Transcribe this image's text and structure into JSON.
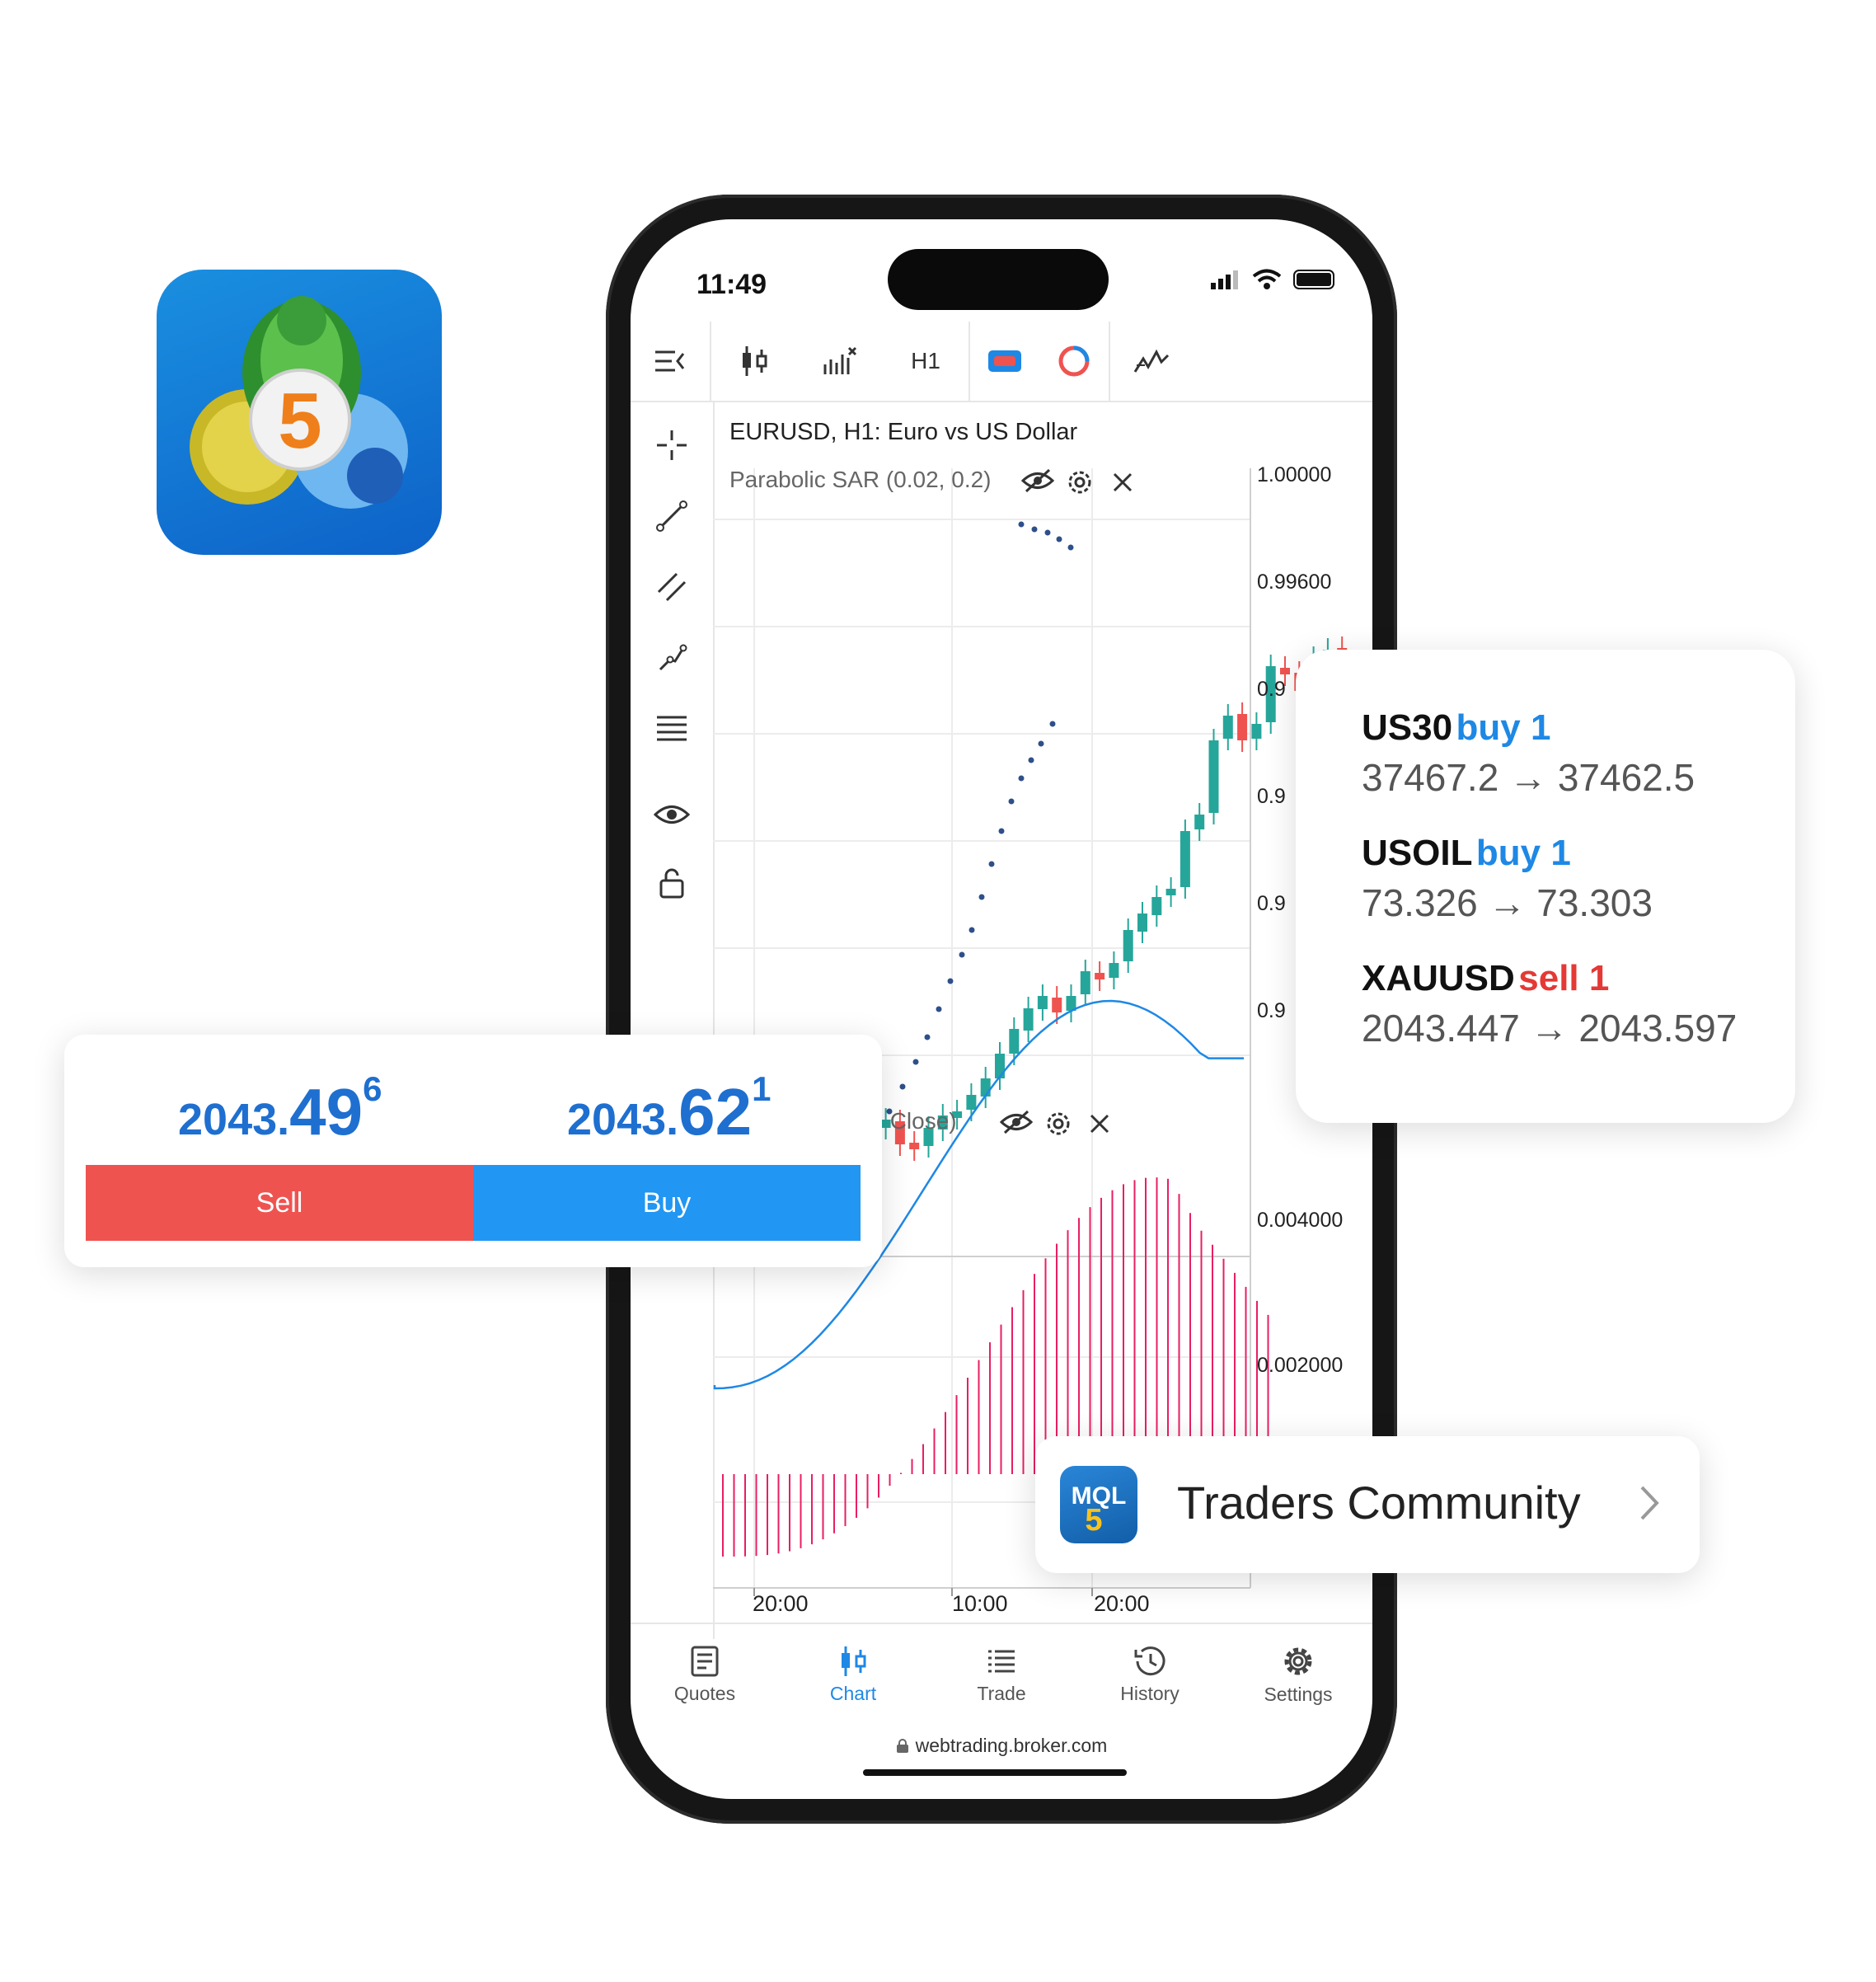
{
  "status_bar": {
    "time": "11:49"
  },
  "toolbar": {
    "timeframe": "H1"
  },
  "chart": {
    "title": "EURUSD, H1: Euro vs US Dollar",
    "indicator_label": "Parabolic SAR (0.02, 0.2)",
    "macd_label": ", 9, Close)",
    "price_labels": [
      "1.00000",
      "0.99600",
      "0.9",
      "0.9",
      "0.9",
      "0.9"
    ],
    "osc_labels": [
      "0.004000",
      "0.002000"
    ],
    "time_labels": [
      "20:00",
      "10:00",
      "20:00"
    ]
  },
  "bottom_nav": {
    "quotes": "Quotes",
    "chart": "Chart",
    "trade": "Trade",
    "history": "History",
    "settings": "Settings"
  },
  "url": "webtrading.broker.com",
  "trade_card": {
    "sell_price": {
      "main": "2043.",
      "big": "49",
      "sup": "6"
    },
    "buy_price": {
      "main": "2043.",
      "big": "62",
      "sup": "1"
    },
    "sell_label": "Sell",
    "buy_label": "Buy"
  },
  "positions": [
    {
      "symbol": "US30",
      "side": "buy 1",
      "range": "37467.2 → 37462.5"
    },
    {
      "symbol": "USOIL",
      "side": "buy 1",
      "range": "73.326 → 73.303"
    },
    {
      "symbol": "XAUUSD",
      "side": "sell 1",
      "range": "2043.447 → 2043.597"
    }
  ],
  "community": {
    "icon_text": "MQL5",
    "label": "Traders Community"
  },
  "colors": {
    "bull": "#26a69a",
    "bear": "#ef5350",
    "sar": "#2f4f8a",
    "accent": "#1e88e5",
    "macd_hist": "#e91e63",
    "signal": "#1e88e5"
  }
}
